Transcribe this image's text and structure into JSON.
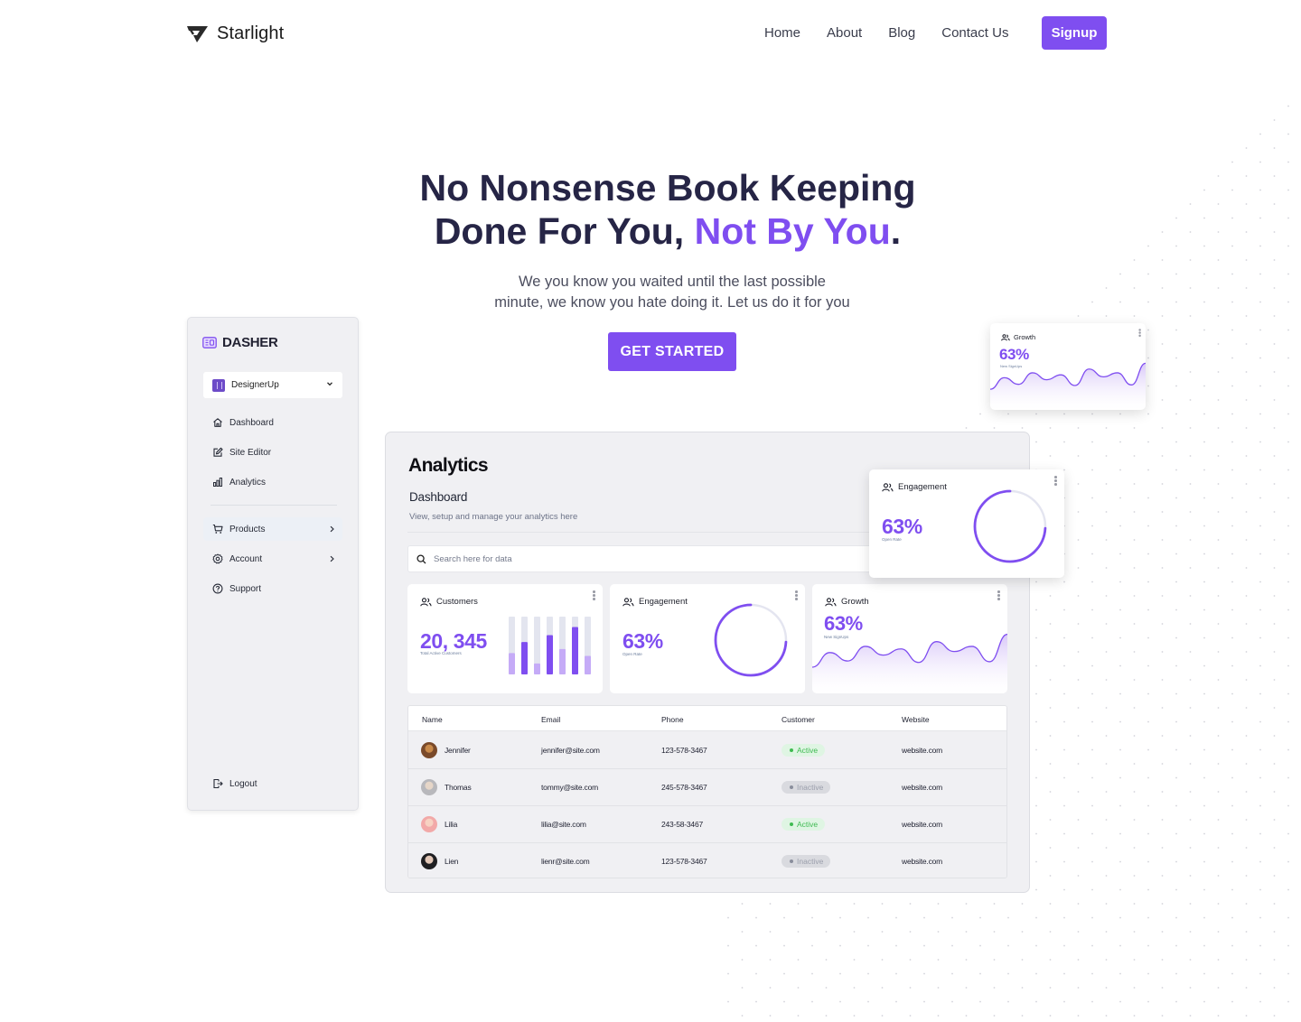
{
  "nav": {
    "brand": "Starlight",
    "links": [
      "Home",
      "About",
      "Blog",
      "Contact Us"
    ],
    "signup_label": "Signup"
  },
  "hero": {
    "title_line1": "No Nonsense Book Keeping",
    "title_line2_main": "Done For You, ",
    "title_line2_accent": "Not By You",
    "title_line2_end": ".",
    "subtitle_line1": "We you know you waited until the last possible",
    "subtitle_line2": "minute, we know you hate doing it. Let us do it for you",
    "cta_label": "GET STARTED"
  },
  "colors": {
    "accent": "#7f4ef0",
    "accent_light": "#c5abf7",
    "heading": "#262546",
    "active_green": "#3fbb52"
  },
  "sidebar": {
    "brand": "DASHER",
    "org": "DesignerUp",
    "items": [
      {
        "label": "Dashboard",
        "icon": "home-icon"
      },
      {
        "label": "Site Editor",
        "icon": "edit-icon"
      },
      {
        "label": "Analytics",
        "icon": "bar-chart-icon"
      },
      {
        "label": "Products",
        "icon": "cart-icon",
        "has_chevron": true
      },
      {
        "label": "Account",
        "icon": "gear-icon",
        "has_chevron": true
      },
      {
        "label": "Support",
        "icon": "help-circle-icon"
      }
    ],
    "logout": "Logout"
  },
  "analytics": {
    "title": "Analytics",
    "subtitle": "Dashboard",
    "description": "View, setup and manage your analytics here",
    "search_placeholder": "Search here for data",
    "cards": {
      "customers": {
        "label": "Customers",
        "value": "20, 345",
        "caption": "Total Active Customers",
        "bars": [
          0.37,
          0.56,
          0.19,
          0.68,
          0.44,
          0.82,
          0.32
        ],
        "bar_emphasis": [
          false,
          true,
          false,
          true,
          false,
          true,
          false
        ]
      },
      "engagement": {
        "label": "Engagement",
        "value": "63%",
        "caption": "Open Rate",
        "progress": 0.74
      },
      "growth": {
        "label": "Growth",
        "value": "63%",
        "caption": "New SignUps",
        "series": [
          0.05,
          0.45,
          0.22,
          0.62,
          0.38,
          0.55,
          0.18,
          0.75,
          0.48,
          0.62,
          0.2,
          0.95
        ]
      }
    },
    "table": {
      "columns": [
        "Name",
        "Email",
        "Phone",
        "Customer",
        "Website"
      ],
      "rows": [
        {
          "name": "Jennifer",
          "email": "jennifer@site.com",
          "phone": "123-578-3467",
          "status": "Active",
          "website": "website.com"
        },
        {
          "name": "Thomas",
          "email": "tommy@site.com",
          "phone": "245-578-3467",
          "status": "Inactive",
          "website": "website.com"
        },
        {
          "name": "Lilia",
          "email": "lilia@site.com",
          "phone": "243-58-3467",
          "status": "Active",
          "website": "website.com"
        },
        {
          "name": "Lien",
          "email": "lienr@site.com",
          "phone": "123-578-3467",
          "status": "Inactive",
          "website": "website.com"
        }
      ]
    }
  },
  "floating": {
    "growth": {
      "label": "Growth",
      "value": "63%",
      "caption": "New SignUps"
    },
    "engagement": {
      "label": "Engagement",
      "value": "63%",
      "caption": "Open Rate",
      "progress": 0.74
    }
  }
}
